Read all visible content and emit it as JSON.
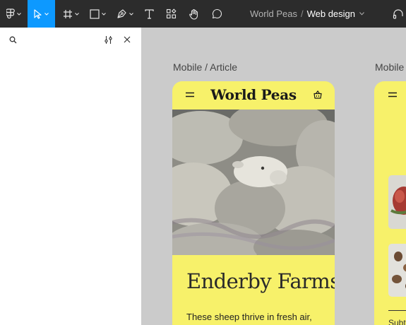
{
  "toolbar": {
    "icons": [
      "figma-menu-icon",
      "move-tool-icon",
      "frame-tool-icon",
      "shape-tool-icon",
      "pen-tool-icon",
      "text-tool-icon",
      "components-icon",
      "hand-tool-icon",
      "comment-icon"
    ],
    "active_tool": "move-tool",
    "file_project": "World Peas",
    "file_separator": "/",
    "file_name": "Web design",
    "accent_color": "#0d99ff",
    "background": "#2c2c2c"
  },
  "left_panel": {
    "search_placeholder": "",
    "icons": [
      "search-icon",
      "filter-settings-icon",
      "close-icon"
    ]
  },
  "canvas": {
    "background": "#cbcbcb",
    "frames": [
      {
        "label": "Mobile / Article",
        "brand": "World Peas",
        "title": "Enderby Farms",
        "body_text": "These sheep thrive in fresh air,",
        "background": "#f7f16a",
        "image": "photo of sheep flock"
      },
      {
        "label": "Mobile",
        "sub_text": "Subt",
        "background": "#f7f16a"
      }
    ]
  }
}
